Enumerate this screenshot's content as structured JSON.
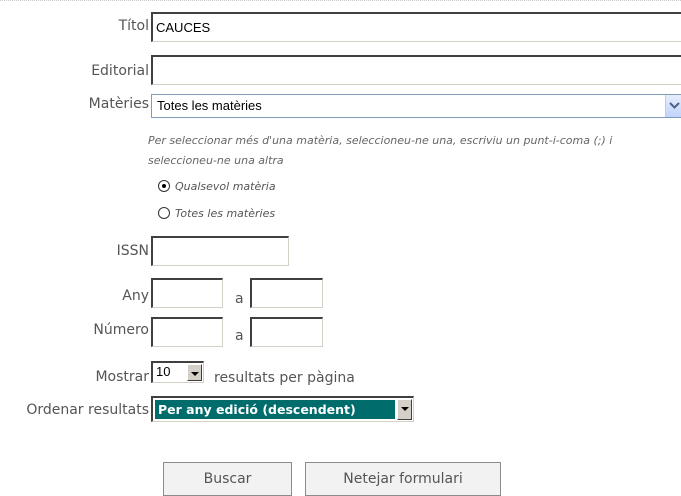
{
  "form": {
    "titol": {
      "label": "Títol",
      "value": "CAUCES"
    },
    "editorial": {
      "label": "Editorial",
      "value": ""
    },
    "materies": {
      "label": "Matèries",
      "selected": "Totes les matèries",
      "dropdown_icon": "chevron-down-icon",
      "hint": "Per seleccionar més d'una matèria, seleccioneu-ne una, escriviu un punt-i-coma (;) i seleccioneu-ne una altra",
      "radio_options": [
        {
          "label": "Qualsevol matèria",
          "checked": true
        },
        {
          "label": "Totes les matèries",
          "checked": false
        }
      ]
    },
    "issn": {
      "label": "ISSN",
      "value": ""
    },
    "any": {
      "label": "Any",
      "from": "",
      "separator": "a",
      "to": ""
    },
    "numero": {
      "label": "Número",
      "from": "",
      "separator": "a",
      "to": ""
    },
    "mostrar": {
      "label": "Mostrar",
      "value": "10",
      "suffix": "resultats per pàgina"
    },
    "ordenar": {
      "label": "Ordenar resultats",
      "value": "Per any edició (descendent)",
      "highlight_color": "#006c6c"
    }
  },
  "buttons": {
    "search": "Buscar",
    "reset": "Netejar formulari"
  }
}
